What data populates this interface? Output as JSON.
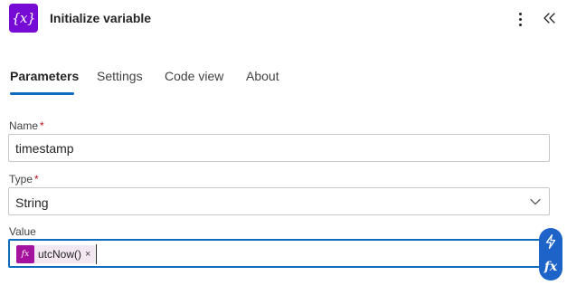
{
  "header": {
    "icon_text": "{x}",
    "title": "Initialize variable"
  },
  "tabs": [
    {
      "label": "Parameters",
      "active": true
    },
    {
      "label": "Settings",
      "active": false
    },
    {
      "label": "Code view",
      "active": false
    },
    {
      "label": "About",
      "active": false
    }
  ],
  "fields": {
    "name": {
      "label": "Name",
      "required_mark": "*",
      "value": "timestamp"
    },
    "type": {
      "label": "Type",
      "required_mark": "*",
      "value": "String"
    },
    "value": {
      "label": "Value",
      "token": {
        "icon": "fx",
        "text": "utcNow()",
        "remove": "×"
      }
    }
  },
  "side_buttons": {
    "dynamic_content_icon": "lightning-icon",
    "expression_label": "fx"
  },
  "colors": {
    "action_icon_bg": "#770bd6",
    "accent": "#0f6cbd",
    "token_icon_bg": "#a5129d",
    "side_pill_bg": "#1e64c8",
    "required": "#c50f1f"
  }
}
